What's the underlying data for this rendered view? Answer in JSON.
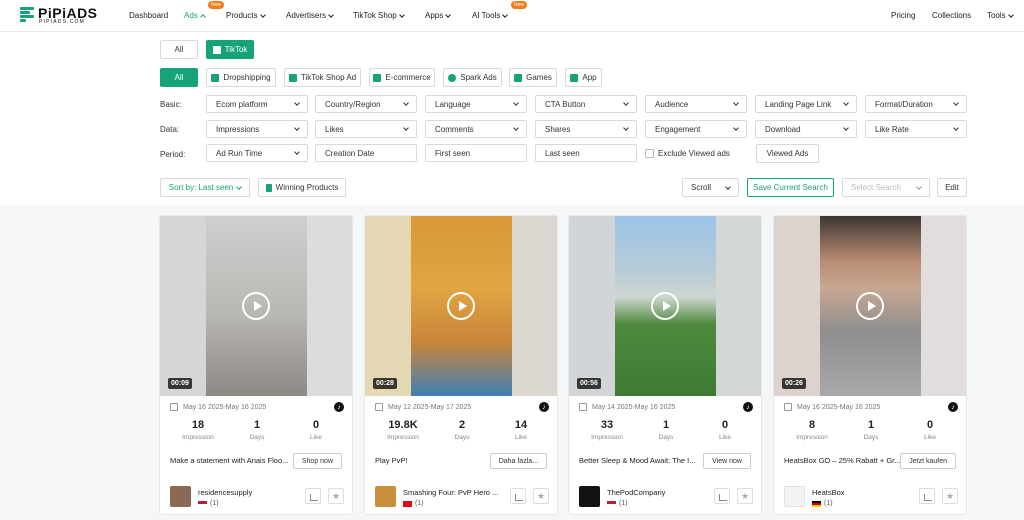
{
  "brand": {
    "name": "PiPiADS",
    "sub": "PIPIADS.COM",
    "accent": "#16a37a"
  },
  "nav": {
    "items": [
      {
        "label": "Dashboard"
      },
      {
        "label": "Ads",
        "badge": "New"
      },
      {
        "label": "Products"
      },
      {
        "label": "Advertisers"
      },
      {
        "label": "TikTok Shop"
      },
      {
        "label": "Apps"
      },
      {
        "label": "AI Tools",
        "badge": "New"
      }
    ],
    "right": [
      {
        "label": "Pricing"
      },
      {
        "label": "Collections"
      },
      {
        "label": "Tools"
      }
    ]
  },
  "platform_tabs": [
    {
      "label": "All"
    },
    {
      "label": "TikTok"
    }
  ],
  "type_chips": [
    {
      "label": "All"
    },
    {
      "label": "Dropshipping"
    },
    {
      "label": "TikTok Shop Ad"
    },
    {
      "label": "E-commerce"
    },
    {
      "label": "Spark Ads"
    },
    {
      "label": "Games"
    },
    {
      "label": "App"
    }
  ],
  "filters": {
    "basic_label": "Basic:",
    "data_label": "Data:",
    "period_label": "Period:",
    "basic": [
      "Ecom platform",
      "Country/Region",
      "Language",
      "CTA Button",
      "Audience",
      "Landing Page Link",
      "Format/Duration"
    ],
    "data": [
      "Impressions",
      "Likes",
      "Comments",
      "Shares",
      "Engagement",
      "Download",
      "Like Rate"
    ],
    "period": {
      "ad_run_time": "Ad Run Time",
      "creation_date": "Creation Date",
      "first_seen": "First seen",
      "last_seen": "Last seen",
      "exclude_label": "Exclude Viewed ads",
      "viewed_button": "Viewed Ads"
    }
  },
  "toolbar": {
    "sort": "Sort by: Last seen",
    "winning": "Winning Products",
    "scroll": "Scroll",
    "save_search": "Save Current Search",
    "select_search_placeholder": "Select Search",
    "edit": "Edit"
  },
  "cards": [
    {
      "duration": "00:09",
      "dates": "May 16 2025-May 16 2025",
      "impression": "18",
      "days": "1",
      "like": "0",
      "impression_label": "Impression",
      "days_label": "Days",
      "like_label": "Like",
      "title": "Make a statement with Anais Floo...",
      "cta": "Shop now",
      "advertiser": "residencesupply",
      "count": "(1)"
    },
    {
      "duration": "00:28",
      "dates": "May 12 2025-May 17 2025",
      "impression": "19.8K",
      "days": "2",
      "like": "14",
      "impression_label": "Impression",
      "days_label": "Days",
      "like_label": "Like",
      "title": "Play PvP!",
      "cta": "Daha fazla...",
      "advertiser": "Smashing Four: PvP Hero ...",
      "count": "(1)"
    },
    {
      "duration": "00:56",
      "dates": "May 14 2025-May 16 2025",
      "impression": "33",
      "days": "1",
      "like": "0",
      "impression_label": "Impression",
      "days_label": "Days",
      "like_label": "Like",
      "title": "Better Sleep & Mood Await: The I...",
      "cta": "View now",
      "advertiser": "ThePodCompany",
      "count": "(1)"
    },
    {
      "duration": "00:26",
      "dates": "May 16 2025-May 16 2025",
      "impression": "8",
      "days": "1",
      "like": "0",
      "impression_label": "Impression",
      "days_label": "Days",
      "like_label": "Like",
      "title": "HeatsBox GO – 25% Rabatt + Gr...",
      "cta": "Jetzt kaufen",
      "advertiser": "HeatsBox",
      "count": "(1)"
    }
  ]
}
